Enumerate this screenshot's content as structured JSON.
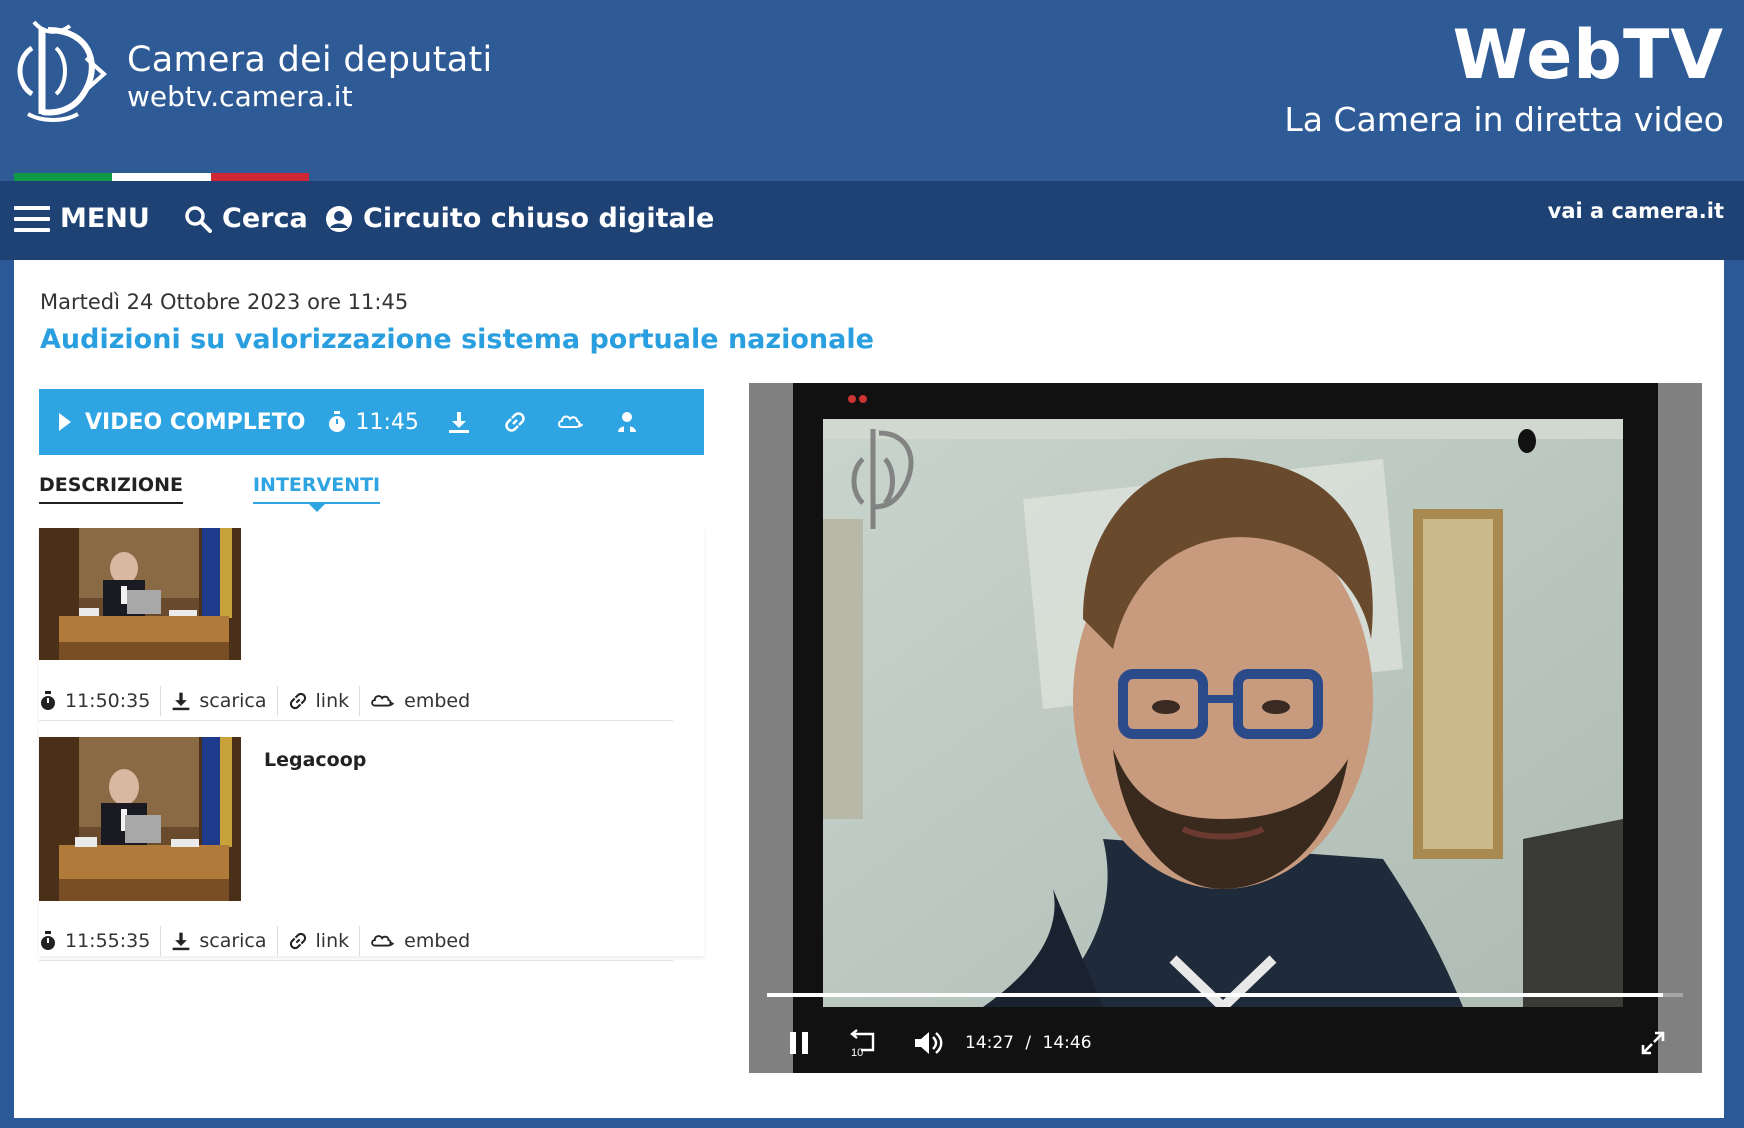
{
  "header": {
    "site_title": "Camera dei deputati",
    "site_url": "webtv.camera.it",
    "brand_title": "WebTV",
    "brand_subtitle": "La Camera in diretta video",
    "tricolor": [
      "#0f9a48",
      "#ffffff",
      "#cf2734"
    ]
  },
  "nav": {
    "menu_label": "MENU",
    "search_label": "Cerca",
    "circuito_label": "Circuito chiuso digitale",
    "external_link": "vai a camera.it"
  },
  "event": {
    "date": "Martedì 24 Ottobre 2023 ore 11:45",
    "title": "Audizioni su valorizzazione sistema portuale nazionale"
  },
  "toolbar": {
    "video_label": "VIDEO COMPLETO",
    "duration": "11:45",
    "icons": [
      "download-icon",
      "link-icon",
      "embed-icon",
      "speaker-icon"
    ]
  },
  "tabs": {
    "description": "DESCRIZIONE",
    "interventions": "INTERVENTI"
  },
  "interventions": [
    {
      "speaker": "",
      "time": "11:50:35",
      "download_label": "scarica",
      "link_label": "link",
      "embed_label": "embed"
    },
    {
      "speaker": "Legacoop",
      "time": "11:55:35",
      "download_label": "scarica",
      "link_label": "link",
      "embed_label": "embed"
    }
  ],
  "player": {
    "current_time": "14:27",
    "separator": "/",
    "total_time": "14:46",
    "progress": 0.978
  },
  "colors": {
    "header_bg": "#2e5a96",
    "nav_bg": "#1f4275",
    "accent": "#2ea4e3"
  }
}
